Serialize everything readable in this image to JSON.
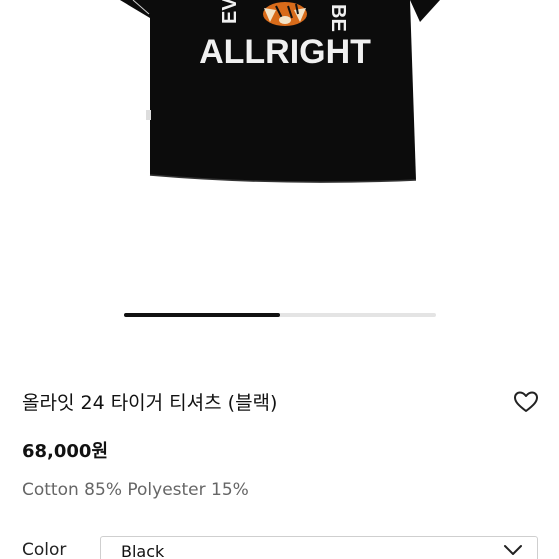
{
  "product_image": {
    "print_text_top_left": "EV",
    "print_text_top_right": "BE",
    "print_text_main": "ALLRIGHT",
    "shirt_color": "#0c0c0c",
    "carousel_progress": 0.5
  },
  "product": {
    "title": "올라잇 24 타이거 티셔츠 (블랙)",
    "price": "68,000원",
    "material": "Cotton 85% Polyester 15%"
  },
  "option": {
    "label": "Color",
    "selected": "Black"
  },
  "icons": {
    "wishlist": "heart-outline-icon",
    "dropdown": "chevron-down-icon"
  }
}
